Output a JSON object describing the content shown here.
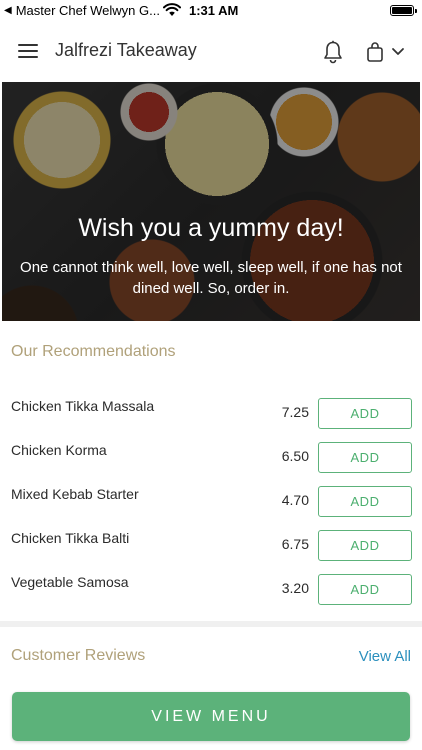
{
  "status_bar": {
    "back_glyph": "◀",
    "carrier": "Master Chef Welwyn G...",
    "time": "1:31 AM"
  },
  "header": {
    "title": "Jalfrezi Takeaway",
    "icons": [
      "menu-icon",
      "bell-icon",
      "bag-icon",
      "chevron-down-icon"
    ]
  },
  "hero": {
    "title": "Wish you a yummy day!",
    "subtitle": "One cannot think well, love well, sleep well, if one has not dined well. So, order in."
  },
  "recommendations": {
    "title": "Our Recommendations",
    "add_label": "ADD",
    "items": [
      {
        "name": "Chicken Tikka Massala",
        "price": "7.25"
      },
      {
        "name": "Chicken Korma",
        "price": "6.50"
      },
      {
        "name": "Mixed Kebab Starter",
        "price": "4.70"
      },
      {
        "name": "Chicken Tikka Balti",
        "price": "6.75"
      },
      {
        "name": "Vegetable Samosa",
        "price": "3.20"
      }
    ]
  },
  "reviews": {
    "title": "Customer Reviews",
    "view_all": "View All"
  },
  "footer": {
    "view_menu": "VIEW MENU"
  },
  "colors": {
    "accent_green": "#5cb27a",
    "section_title": "#b0a17a",
    "link_blue": "#2a8fbd"
  }
}
